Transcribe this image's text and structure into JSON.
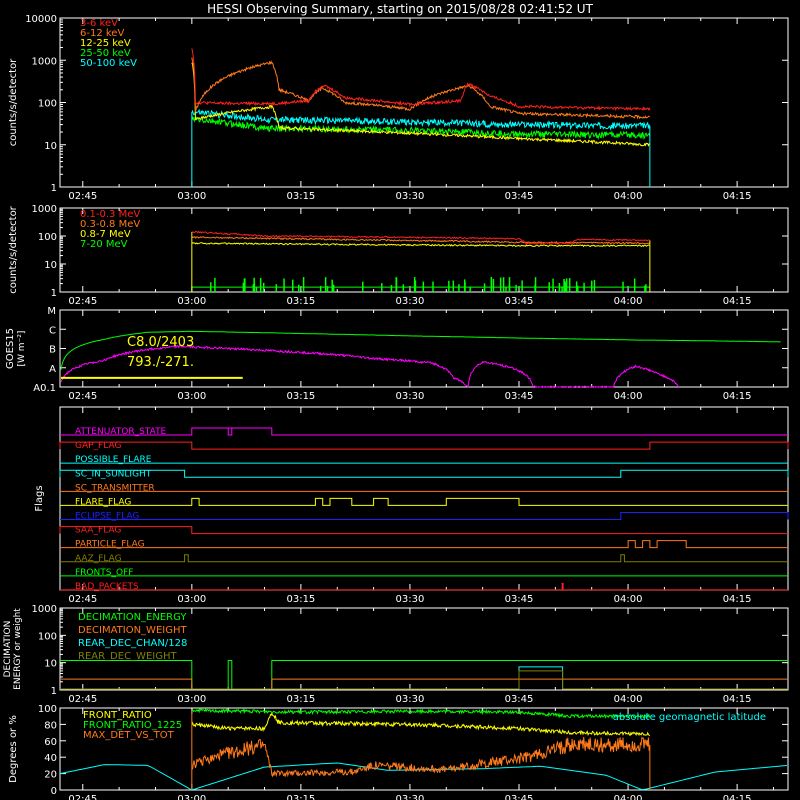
{
  "title": "HESSI Observing Summary, starting on 2015/08/28 02:41:52 UT",
  "time_ticks": [
    "02:45",
    "03:00",
    "03:15",
    "03:30",
    "03:45",
    "04:00",
    "04:15"
  ],
  "chart_data": [
    {
      "type": "line",
      "panel": "lightcurves",
      "ylabel": "counts/s/detector",
      "yscale": "log",
      "ylim": [
        1,
        10000
      ],
      "yticks": [
        "1",
        "10",
        "100",
        "1000",
        "10000"
      ],
      "legend": [
        {
          "name": "3-6 keV",
          "color": "#ff2020"
        },
        {
          "name": "6-12 keV",
          "color": "#ff7a1a"
        },
        {
          "name": "12-25 keV",
          "color": "#ffff00"
        },
        {
          "name": "25-50 keV",
          "color": "#00ff00"
        },
        {
          "name": "50-100 keV",
          "color": "#00ffff"
        }
      ],
      "data_window": [
        "03:00",
        "04:03"
      ],
      "series": [
        {
          "name": "3-6 keV",
          "color": "#ff2020",
          "points": [
            [
              "03:00",
              2000
            ],
            [
              "03:00:30",
              100
            ],
            [
              "03:05",
              95
            ],
            [
              "03:12",
              95
            ],
            [
              "03:16",
              110
            ],
            [
              "03:18",
              260
            ],
            [
              "03:21",
              130
            ],
            [
              "03:30",
              90
            ],
            [
              "03:37",
              110
            ],
            [
              "03:38",
              280
            ],
            [
              "03:41",
              140
            ],
            [
              "03:45",
              80
            ],
            [
              "04:03",
              70
            ]
          ]
        },
        {
          "name": "6-12 keV",
          "color": "#ff7a1a",
          "points": [
            [
              "03:00",
              1200
            ],
            [
              "03:00:30",
              60
            ],
            [
              "03:11",
              900
            ],
            [
              "03:12",
              200
            ],
            [
              "03:16",
              110
            ],
            [
              "03:18",
              220
            ],
            [
              "03:21",
              100
            ],
            [
              "03:30",
              70
            ],
            [
              "03:38",
              250
            ],
            [
              "03:41",
              80
            ],
            [
              "03:45",
              55
            ],
            [
              "04:03",
              45
            ]
          ]
        },
        {
          "name": "12-25 keV",
          "color": "#ffff00",
          "points": [
            [
              "03:00",
              900
            ],
            [
              "03:00:30",
              40
            ],
            [
              "03:11",
              80
            ],
            [
              "03:12",
              25
            ],
            [
              "03:20",
              22
            ],
            [
              "03:45",
              14
            ],
            [
              "04:03",
              10
            ]
          ]
        },
        {
          "name": "25-50 keV",
          "color": "#00ff00",
          "points": [
            [
              "03:00",
              40
            ],
            [
              "03:10",
              25
            ],
            [
              "03:30",
              22
            ],
            [
              "03:45",
              18
            ],
            [
              "04:03",
              17
            ]
          ]
        },
        {
          "name": "50-100 keV",
          "color": "#00ffff",
          "points": [
            [
              "03:00",
              60
            ],
            [
              "03:10",
              40
            ],
            [
              "03:30",
              35
            ],
            [
              "03:45",
              30
            ],
            [
              "04:03",
              28
            ]
          ]
        }
      ]
    },
    {
      "type": "line",
      "panel": "high-energy-lightcurves",
      "ylabel": "counts/s/detector",
      "yscale": "log",
      "ylim": [
        1,
        1000
      ],
      "yticks": [
        "1",
        "10",
        "100",
        "1000"
      ],
      "legend": [
        {
          "name": "0.1-0.3 MeV",
          "color": "#ff2020"
        },
        {
          "name": "0.3-0.8 MeV",
          "color": "#ff7a1a"
        },
        {
          "name": "0.8-7 MeV",
          "color": "#ffff00"
        },
        {
          "name": "7-20 MeV",
          "color": "#00ff00"
        }
      ],
      "series": [
        {
          "name": "0.1-0.3 MeV",
          "color": "#ff2020",
          "points": [
            [
              "03:00",
              140
            ],
            [
              "03:10",
              100
            ],
            [
              "03:30",
              90
            ],
            [
              "03:45",
              80
            ],
            [
              "03:46",
              55
            ],
            [
              "03:52",
              55
            ],
            [
              "03:53",
              75
            ],
            [
              "04:03",
              70
            ]
          ]
        },
        {
          "name": "0.3-0.8 MeV",
          "color": "#ff7a1a",
          "points": [
            [
              "03:00",
              90
            ],
            [
              "03:20",
              75
            ],
            [
              "03:45",
              60
            ],
            [
              "04:03",
              55
            ]
          ]
        },
        {
          "name": "0.8-7 MeV",
          "color": "#ffff00",
          "points": [
            [
              "03:00",
              55
            ],
            [
              "03:20",
              50
            ],
            [
              "03:45",
              45
            ],
            [
              "04:03",
              45
            ]
          ]
        },
        {
          "name": "7-20 MeV",
          "color": "#00ff00",
          "points": [
            [
              "03:00",
              2.5
            ],
            [
              "04:03",
              1.5
            ]
          ]
        }
      ]
    },
    {
      "type": "line",
      "panel": "goes",
      "ylabel": "GOES15",
      "yunit": "[W m⁻²]",
      "yscale": "log",
      "ylim": [
        1e-08,
        0.0001
      ],
      "yticks": [
        "A0.1",
        "A",
        "B",
        "C",
        "M"
      ],
      "annotations": [
        "C8.0/2403",
        "793./-271."
      ],
      "marker_line": {
        "from": "02:42",
        "to": "03:07"
      },
      "series": [
        {
          "name": "long",
          "color": "#00ff00",
          "points": [
            [
              "02:42",
              8e-08
            ],
            [
              "02:48",
              3e-06
            ],
            [
              "02:54",
              7e-06
            ],
            [
              "03:00",
              7.8e-06
            ],
            [
              "03:15",
              6e-06
            ],
            [
              "03:30",
              4.5e-06
            ],
            [
              "03:45",
              3.5e-06
            ],
            [
              "04:00",
              2.8e-06
            ],
            [
              "04:15",
              2.4e-06
            ],
            [
              "04:21",
              2.2e-06
            ]
          ]
        },
        {
          "name": "short",
          "color": "#ff00ff",
          "points": [
            [
              "02:42",
              2e-08
            ],
            [
              "02:48",
              2.5e-07
            ],
            [
              "02:54",
              9e-07
            ],
            [
              "02:58",
              1.3e-06
            ],
            [
              "03:10",
              8e-07
            ],
            [
              "03:25",
              3e-07
            ],
            [
              "03:33",
              1.8e-07
            ],
            [
              "03:36",
              3e-08
            ],
            [
              "03:38",
              1e-08
            ],
            [
              "03:40",
              2e-07
            ],
            [
              "03:44",
              1e-07
            ],
            [
              "03:47",
              1e-08
            ],
            [
              "03:58",
              1e-08
            ],
            [
              "04:01",
              1.2e-07
            ],
            [
              "04:04",
              5e-08
            ],
            [
              "04:07",
              1e-08
            ]
          ]
        }
      ]
    },
    {
      "type": "line",
      "panel": "flags",
      "ylabel": "Flags",
      "flags": [
        {
          "name": "ATTENUATOR_STATE",
          "color": "#ff00ff",
          "on": [
            [
              "03:00",
              "03:11"
            ]
          ],
          "notch": [
            "03:05",
            "03:05:30"
          ]
        },
        {
          "name": "GAP_FLAG",
          "color": "#ff2020",
          "on": [
            [
              "02:41:52",
              "03:00"
            ],
            [
              "04:03",
              "04:22"
            ]
          ]
        },
        {
          "name": "POSSIBLE_FLARE",
          "color": "#00ffff",
          "on": []
        },
        {
          "name": "SC_IN_SUNLIGHT",
          "color": "#00ffff",
          "on": [
            [
              "02:41:52",
              "02:59"
            ],
            [
              "03:59",
              "04:22"
            ]
          ]
        },
        {
          "name": "SC_TRANSMITTER",
          "color": "#ff7a1a",
          "on": []
        },
        {
          "name": "FLARE_FLAG",
          "color": "#ffff00",
          "on": [
            [
              "03:00",
              "03:01"
            ],
            [
              "03:17",
              "03:18"
            ],
            [
              "03:19",
              "03:22"
            ],
            [
              "03:25",
              "03:27"
            ],
            [
              "03:35",
              "03:45"
            ]
          ]
        },
        {
          "name": "ECLIPSE_FLAG",
          "color": "#2020ff",
          "on": [
            [
              "03:59",
              "04:22"
            ]
          ]
        },
        {
          "name": "SAA_FLAG",
          "color": "#ff2020",
          "on": [
            [
              "02:41:52",
              "03:00"
            ]
          ]
        },
        {
          "name": "PARTICLE_FLAG",
          "color": "#ff7a1a",
          "on": [
            [
              "04:00",
              "04:01"
            ],
            [
              "04:02",
              "04:03"
            ],
            [
              "04:04",
              "04:08"
            ]
          ]
        },
        {
          "name": "AAZ_FLAG",
          "color": "#808000",
          "on": [
            [
              "02:59",
              "02:59:30"
            ],
            [
              "03:59",
              "03:59:30"
            ]
          ]
        },
        {
          "name": "FRONTS_OFF",
          "color": "#00ff00",
          "on": []
        },
        {
          "name": "BAD_PACKETS",
          "color": "#ff2020",
          "on": [],
          "spikes": [
            "03:51"
          ]
        }
      ]
    },
    {
      "type": "line",
      "panel": "decimation",
      "ylabel": "DECIMATION ENERGY or weight",
      "yscale": "log",
      "ylim": [
        1,
        1000
      ],
      "yticks": [
        "1",
        "10",
        "100",
        "1000"
      ],
      "legend": [
        {
          "name": "DECIMATION_ENERGY",
          "color": "#00ff00"
        },
        {
          "name": "DECIMATION_WEIGHT",
          "color": "#ff7a1a"
        },
        {
          "name": "REAR_DEC_CHAN/128",
          "color": "#00ffff"
        },
        {
          "name": "REAR_DEC_WEIGHT",
          "color": "#808000"
        }
      ],
      "series": [
        {
          "name": "DECIMATION_ENERGY",
          "color": "#00ff00",
          "points": [
            [
              "02:41:52",
              12
            ],
            [
              "03:00",
              12
            ],
            [
              "03:00",
              1
            ],
            [
              "03:05",
              1
            ],
            [
              "03:05",
              12
            ],
            [
              "03:05:30",
              12
            ],
            [
              "03:05:30",
              1
            ],
            [
              "03:11",
              1
            ],
            [
              "03:11",
              12
            ],
            [
              "04:22",
              12
            ]
          ]
        },
        {
          "name": "DECIMATION_WEIGHT",
          "color": "#ff7a1a",
          "points": [
            [
              "02:41:52",
              2.5
            ],
            [
              "03:00",
              2.5
            ],
            [
              "03:00",
              1
            ],
            [
              "03:11",
              1
            ],
            [
              "03:11",
              2.5
            ],
            [
              "04:22",
              2.5
            ]
          ]
        },
        {
          "name": "REAR_DEC_CHAN/128",
          "color": "#00ffff",
          "points": [
            [
              "02:41:52",
              1
            ],
            [
              "03:45",
              1
            ],
            [
              "03:45",
              7
            ],
            [
              "03:51",
              7
            ],
            [
              "03:51",
              1
            ],
            [
              "04:22",
              1
            ]
          ]
        },
        {
          "name": "REAR_DEC_WEIGHT",
          "color": "#808000",
          "points": [
            [
              "02:41:52",
              1
            ],
            [
              "03:45",
              1
            ],
            [
              "03:45",
              5
            ],
            [
              "03:51",
              5
            ],
            [
              "03:51",
              1
            ],
            [
              "04:22",
              1
            ]
          ]
        }
      ]
    },
    {
      "type": "line",
      "panel": "ratios",
      "ylabel": "Degrees or %",
      "ylim": [
        0,
        100
      ],
      "yticks": [
        "0",
        "20",
        "40",
        "60",
        "80",
        "100"
      ],
      "legend": [
        {
          "name": "FRONT_RATIO",
          "color": "#ffff00"
        },
        {
          "name": "FRONT_RATIO_1225",
          "color": "#00ff00"
        },
        {
          "name": "MAX_DET_VS_TOT",
          "color": "#ff7a1a"
        }
      ],
      "right_label": {
        "text": "absolute geomagnetic latitude",
        "color": "#00ffff"
      },
      "series": [
        {
          "name": "FRONT_RATIO",
          "color": "#ffff00",
          "points": [
            [
              "03:00",
              80
            ],
            [
              "03:05",
              75
            ],
            [
              "03:10",
              75
            ],
            [
              "03:11",
              95
            ],
            [
              "03:12",
              82
            ],
            [
              "03:30",
              80
            ],
            [
              "03:45",
              75
            ],
            [
              "03:52",
              70
            ],
            [
              "04:03",
              68
            ]
          ]
        },
        {
          "name": "FRONT_RATIO_1225",
          "color": "#00ff00",
          "points": [
            [
              "03:00",
              97
            ],
            [
              "03:15",
              95
            ],
            [
              "03:30",
              96
            ],
            [
              "03:45",
              95
            ],
            [
              "03:52",
              90
            ],
            [
              "04:03",
              90
            ]
          ]
        },
        {
          "name": "MAX_DET_VS_TOT",
          "color": "#ff7a1a",
          "points": [
            [
              "03:00",
              30
            ],
            [
              "03:05",
              45
            ],
            [
              "03:10",
              55
            ],
            [
              "03:11",
              20
            ],
            [
              "03:22",
              22
            ],
            [
              "03:25",
              30
            ],
            [
              "03:35",
              25
            ],
            [
              "03:42",
              35
            ],
            [
              "03:46",
              40
            ],
            [
              "03:52",
              55
            ],
            [
              "04:03",
              55
            ]
          ]
        },
        {
          "name": "absolute geomagnetic latitude",
          "color": "#00ffff",
          "points": [
            [
              "02:41:52",
              20
            ],
            [
              "02:48",
              31
            ],
            [
              "02:54",
              30
            ],
            [
              "03:00",
              0
            ],
            [
              "03:10",
              28
            ],
            [
              "03:20",
              33
            ],
            [
              "03:27",
              24
            ],
            [
              "03:40",
              26
            ],
            [
              "03:48",
              29
            ],
            [
              "03:57",
              18
            ],
            [
              "04:02",
              0
            ],
            [
              "04:12",
              22
            ],
            [
              "04:22",
              30
            ]
          ]
        }
      ]
    }
  ]
}
